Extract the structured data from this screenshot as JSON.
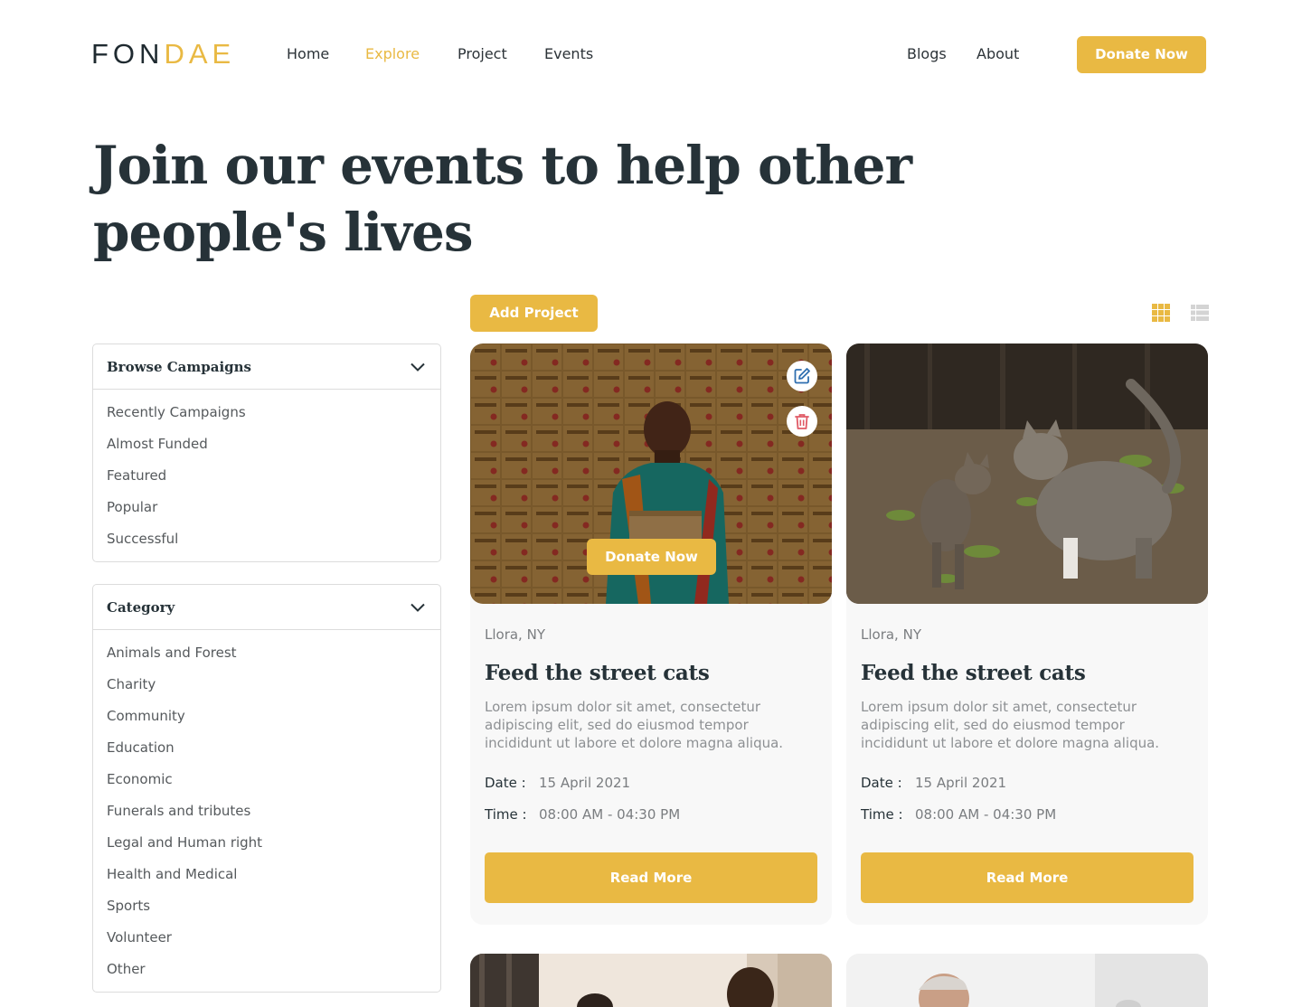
{
  "brand": {
    "logo_dark": "FON",
    "logo_gold": "DAE"
  },
  "nav": {
    "home": "Home",
    "explore": "Explore",
    "project": "Project",
    "events": "Events",
    "blogs": "Blogs",
    "about": "About",
    "donate_label": "Donate Now"
  },
  "hero": {
    "title": "Join our events to help other people's lives"
  },
  "toolbar": {
    "add_project_label": "Add Project",
    "grid_view_icon": "grid-icon",
    "list_view_icon": "list-icon"
  },
  "browse_campaigns": {
    "title": "Browse Campaigns",
    "items": [
      "Recently Campaigns",
      "Almost Funded",
      "Featured",
      "Popular",
      "Successful"
    ]
  },
  "category": {
    "title": "Category",
    "items": [
      "Animals and Forest",
      "Charity",
      "Community",
      "Education",
      "Economic",
      "Funerals and tributes",
      "Legal and Human right",
      "Health and Medical",
      "Sports",
      "Volunteer",
      "Other"
    ]
  },
  "cards": [
    {
      "location": "Llora, NY",
      "title": "Feed the street cats",
      "description": "Lorem ipsum dolor sit amet, consectetur adipiscing elit, sed do eiusmod tempor incididunt ut labore et dolore magna aliqua.",
      "date_label": "Date :",
      "date_value": "15 April 2021",
      "time_label": "Time :",
      "time_value": "08:00 AM - 04:30 PM",
      "read_more": "Read More",
      "overlay_donate": "Donate Now"
    },
    {
      "location": "Llora, NY",
      "title": "Feed the street cats",
      "description": "Lorem ipsum dolor sit amet, consectetur adipiscing elit, sed do eiusmod tempor incididunt ut labore et dolore magna aliqua.",
      "date_label": "Date :",
      "date_value": "15 April 2021",
      "time_label": "Time :",
      "time_value": "08:00 AM - 04:30 PM",
      "read_more": "Read More"
    }
  ],
  "colors": {
    "accent": "#e9b943",
    "text_dark": "#263238",
    "text_muted": "#7a7d80",
    "card_bg": "#f8f8f8",
    "delete_red": "#e05a66",
    "edit_blue": "#2f6fb0"
  }
}
